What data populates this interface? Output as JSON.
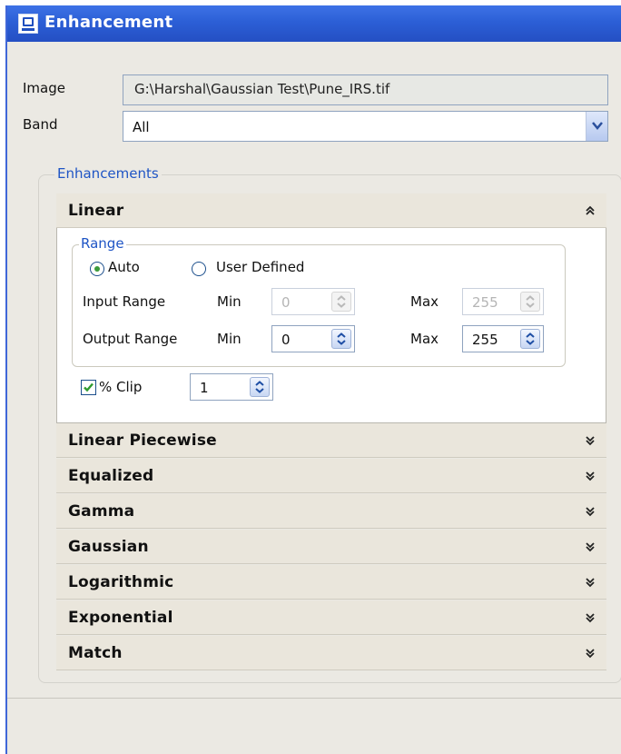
{
  "window": {
    "title": "Enhancement"
  },
  "form": {
    "image_label": "Image",
    "image_value": "G:\\Harshal\\Gaussian Test\\Pune_IRS.tif",
    "band_label": "Band",
    "band_value": "All"
  },
  "enhancements": {
    "legend": "Enhancements",
    "linear": {
      "title": "Linear",
      "range_legend": "Range",
      "auto_label": "Auto",
      "user_defined_label": "User Defined",
      "selected": "Auto",
      "input_range_label": "Input Range",
      "output_range_label": "Output Range",
      "min_label": "Min",
      "max_label": "Max",
      "input_min": "0",
      "input_max": "255",
      "output_min": "0",
      "output_max": "255",
      "clip_label": "% Clip",
      "clip_checked": true,
      "clip_value": "1"
    },
    "sections": [
      "Linear Piecewise",
      "Equalized",
      "Gamma",
      "Gaussian",
      "Logarithmic",
      "Exponential",
      "Match"
    ]
  },
  "icons": {
    "app": "app-icon",
    "dropdown": "chevron-down-icon",
    "collapse": "double-chevron-up-icon",
    "expand": "double-chevron-down-icon",
    "spinner": "spinner-arrows-icon"
  },
  "colors": {
    "titlebar": "#2c5fd6",
    "accent_text": "#1f55c5",
    "header_bg": "#eae6dc"
  }
}
